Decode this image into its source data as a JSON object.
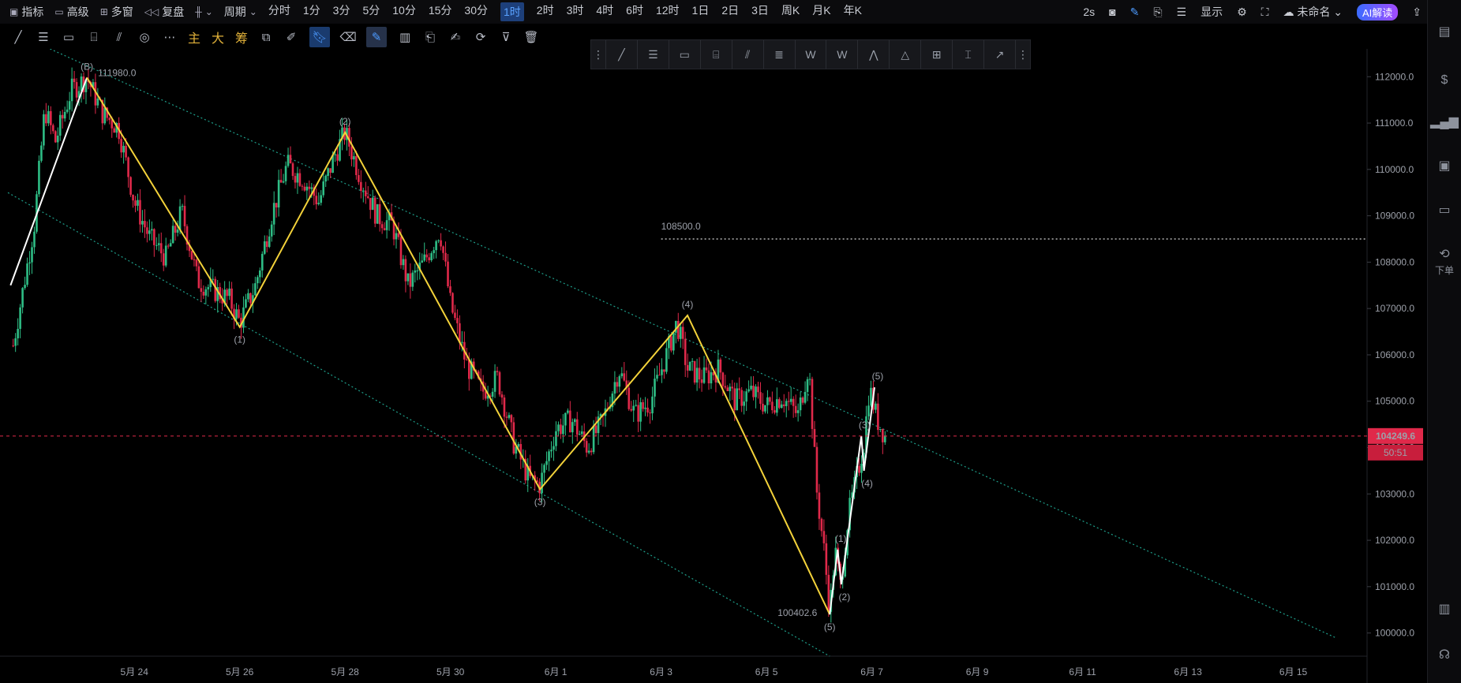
{
  "toolbar": {
    "indicators_label": "指标",
    "advanced_label": "高级",
    "multi_window_label": "多窗",
    "replay_label": "复盘",
    "period_label": "周期",
    "timeframes": [
      "分时",
      "1分",
      "3分",
      "5分",
      "10分",
      "15分",
      "30分",
      "1时",
      "2时",
      "3时",
      "4时",
      "6时",
      "12时",
      "1日",
      "2日",
      "3日",
      "周K",
      "月K",
      "年K"
    ],
    "active_timeframe": "1时",
    "refresh_label": "2s",
    "display_label": "显示",
    "layout_name": "未命名",
    "ai_label": "AI解读"
  },
  "draw_tools": {
    "main_label": "主",
    "big_label": "大",
    "chip_label": "筹"
  },
  "sidebar": {
    "order_label": "下单"
  },
  "chart_data": {
    "type": "candlestick",
    "y_axis": {
      "min": 99500,
      "max": 112600,
      "ticks": [
        100000,
        101000,
        102000,
        103000,
        104000,
        105000,
        106000,
        107000,
        108000,
        109000,
        110000,
        111000,
        112000
      ]
    },
    "y_tick_labels": [
      "100000.0",
      "101000.0",
      "102000.0",
      "103000.0",
      "104000.0",
      "105000.0",
      "106000.0",
      "107000.0",
      "108000.0",
      "109000.0",
      "110000.0",
      "111000.0",
      "112000.0"
    ],
    "x_ticks": [
      {
        "label": "5月 24",
        "t": 1.0
      },
      {
        "label": "5月 26",
        "t": 3.0
      },
      {
        "label": "5月 28",
        "t": 5.0
      },
      {
        "label": "5月 30",
        "t": 7.0
      },
      {
        "label": "6月 1",
        "t": 9.0
      },
      {
        "label": "6月 3",
        "t": 11.0
      },
      {
        "label": "6月 5",
        "t": 13.0
      },
      {
        "label": "6月 7",
        "t": 15.0
      },
      {
        "label": "6月 9",
        "t": 17.0
      },
      {
        "label": "6月 11",
        "t": 19.0
      },
      {
        "label": "6月 13",
        "t": 21.0
      },
      {
        "label": "6月 15",
        "t": 23.0
      }
    ],
    "last_price": "104249.6",
    "countdown": "50:51",
    "high_label": "111980.0",
    "low_label": "100402.6",
    "level_label": "108500.0",
    "level_value": 108500,
    "price_path": [
      {
        "t": -1.3,
        "p": 106200
      },
      {
        "t": -0.9,
        "p": 108800
      },
      {
        "t": -0.7,
        "p": 111300
      },
      {
        "t": -0.5,
        "p": 110600
      },
      {
        "t": -0.2,
        "p": 111700
      },
      {
        "t": 0.1,
        "p": 111980
      },
      {
        "t": 0.4,
        "p": 111200
      },
      {
        "t": 0.7,
        "p": 110900
      },
      {
        "t": 1.0,
        "p": 109300
      },
      {
        "t": 1.3,
        "p": 108500
      },
      {
        "t": 1.6,
        "p": 108100
      },
      {
        "t": 1.9,
        "p": 109100
      },
      {
        "t": 2.2,
        "p": 107600
      },
      {
        "t": 2.5,
        "p": 107400
      },
      {
        "t": 2.8,
        "p": 107200
      },
      {
        "t": 3.0,
        "p": 106700
      },
      {
        "t": 3.3,
        "p": 107500
      },
      {
        "t": 3.6,
        "p": 109000
      },
      {
        "t": 3.9,
        "p": 110100
      },
      {
        "t": 4.2,
        "p": 109800
      },
      {
        "t": 4.5,
        "p": 109300
      },
      {
        "t": 4.8,
        "p": 110300
      },
      {
        "t": 5.0,
        "p": 110800
      },
      {
        "t": 5.3,
        "p": 109800
      },
      {
        "t": 5.6,
        "p": 109000
      },
      {
        "t": 5.9,
        "p": 108800
      },
      {
        "t": 6.2,
        "p": 107500
      },
      {
        "t": 6.5,
        "p": 108000
      },
      {
        "t": 6.8,
        "p": 108700
      },
      {
        "t": 7.0,
        "p": 107100
      },
      {
        "t": 7.3,
        "p": 105800
      },
      {
        "t": 7.6,
        "p": 105200
      },
      {
        "t": 7.9,
        "p": 105500
      },
      {
        "t": 8.2,
        "p": 104100
      },
      {
        "t": 8.5,
        "p": 103300
      },
      {
        "t": 8.7,
        "p": 103200
      },
      {
        "t": 9.0,
        "p": 104400
      },
      {
        "t": 9.3,
        "p": 104600
      },
      {
        "t": 9.6,
        "p": 104000
      },
      {
        "t": 9.9,
        "p": 104600
      },
      {
        "t": 10.2,
        "p": 105700
      },
      {
        "t": 10.5,
        "p": 104700
      },
      {
        "t": 10.8,
        "p": 105000
      },
      {
        "t": 11.1,
        "p": 106000
      },
      {
        "t": 11.3,
        "p": 106700
      },
      {
        "t": 11.5,
        "p": 105700
      },
      {
        "t": 11.8,
        "p": 105500
      },
      {
        "t": 12.1,
        "p": 105700
      },
      {
        "t": 12.4,
        "p": 105000
      },
      {
        "t": 12.7,
        "p": 105200
      },
      {
        "t": 13.0,
        "p": 104900
      },
      {
        "t": 13.3,
        "p": 105100
      },
      {
        "t": 13.6,
        "p": 104700
      },
      {
        "t": 13.8,
        "p": 105800
      },
      {
        "t": 13.95,
        "p": 103100
      },
      {
        "t": 14.1,
        "p": 101700
      },
      {
        "t": 14.2,
        "p": 100450
      },
      {
        "t": 14.3,
        "p": 101800
      },
      {
        "t": 14.4,
        "p": 101000
      },
      {
        "t": 14.55,
        "p": 102500
      },
      {
        "t": 14.7,
        "p": 103300
      },
      {
        "t": 14.85,
        "p": 104100
      },
      {
        "t": 14.95,
        "p": 105300
      },
      {
        "t": 15.1,
        "p": 104600
      },
      {
        "t": 15.25,
        "p": 104250
      }
    ],
    "channel_lines": [
      {
        "name": "upper",
        "from": {
          "t": -0.6,
          "p": 112600
        },
        "to": {
          "t": 15.6,
          "p": 104200
        }
      },
      {
        "name": "lower",
        "from": {
          "t": -1.4,
          "p": 109500
        },
        "to": {
          "t": 14.2,
          "p": 99500
        }
      },
      {
        "name": "upper-ext",
        "from": {
          "t": 15.6,
          "p": 104200
        },
        "to": {
          "t": 23.8,
          "p": 99900
        }
      }
    ],
    "wave_points_yellow": [
      {
        "label": "(B)",
        "t": 0.1,
        "p": 111980
      },
      {
        "label": "(1)",
        "t": 3.0,
        "p": 106600
      },
      {
        "label": "(2)",
        "t": 5.0,
        "p": 110800
      },
      {
        "label": "(3)",
        "t": 8.7,
        "p": 103100
      },
      {
        "label": "(4)",
        "t": 11.5,
        "p": 106850
      },
      {
        "label": "(5)",
        "t": 14.2,
        "p": 100400
      }
    ],
    "wave_points_white": [
      {
        "label": "",
        "t": 14.2,
        "p": 100400
      },
      {
        "label": "(1)",
        "t": 14.35,
        "p": 101800
      },
      {
        "label": "(2)",
        "t": 14.42,
        "p": 101050
      },
      {
        "label": "(3)",
        "t": 14.8,
        "p": 104250
      },
      {
        "label": "(4)",
        "t": 14.85,
        "p": 103500
      },
      {
        "label": "(5)",
        "t": 15.05,
        "p": 105300
      }
    ],
    "white_lead_in": [
      {
        "t": -1.35,
        "p": 107500
      },
      {
        "t": 0.1,
        "p": 111980
      }
    ]
  }
}
